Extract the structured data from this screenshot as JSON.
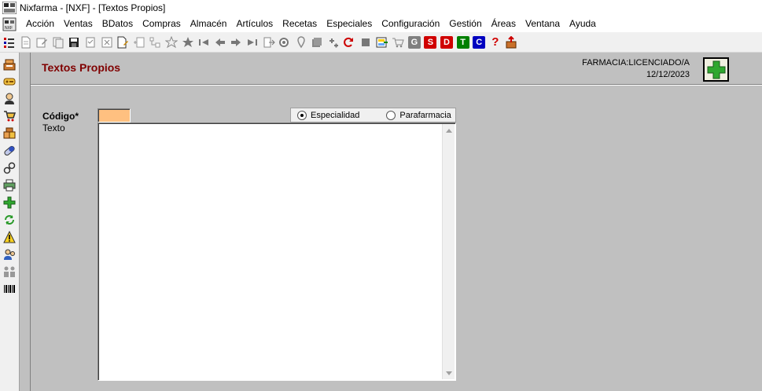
{
  "window": {
    "title": "Nixfarma - [NXF] - [Textos Propios]"
  },
  "menu": [
    "Acción",
    "Ventas",
    "BDatos",
    "Compras",
    "Almacén",
    "Artículos",
    "Recetas",
    "Especiales",
    "Configuración",
    "Gestión",
    "Áreas",
    "Ventana",
    "Ayuda"
  ],
  "toolbar": {
    "letters": [
      {
        "label": "G",
        "color": "#808080"
      },
      {
        "label": "S",
        "color": "#d00000"
      },
      {
        "label": "D",
        "color": "#d00000"
      },
      {
        "label": "T",
        "color": "#008000"
      },
      {
        "label": "C",
        "color": "#0000c0"
      }
    ],
    "help": "?"
  },
  "form": {
    "title": "Textos Propios",
    "farmacia": "FARMACIA:LICENCIADO/A",
    "fecha": "12/12/2023",
    "codigo_label": "Código*",
    "codigo_value": "",
    "texto_label": "Texto",
    "texto_value": "",
    "radio_especialidad": "Especialidad",
    "radio_parafarmacia": "Parafarmacia",
    "selected_radio": "Especialidad"
  },
  "colors": {
    "title": "#800000",
    "codigo_bg": "#ffc080",
    "add": "#2fa82f"
  }
}
